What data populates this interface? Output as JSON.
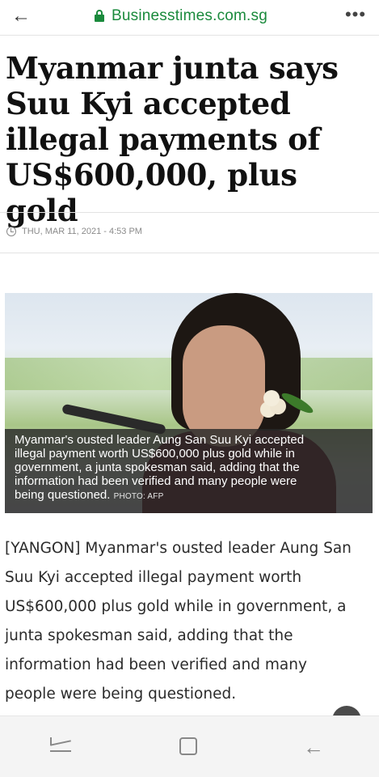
{
  "browser": {
    "url": "Businesstimes.com.sg",
    "back_icon": "←",
    "menu_icon": "•••"
  },
  "article": {
    "headline_lines": [
      "Myanmar junta says",
      "Suu Kyi accepted",
      "illegal payments of",
      "US$600,000, plus gold"
    ],
    "date": "THU, MAR 11, 2021 - 4:53 PM",
    "caption": {
      "lines": [
        "Myanmar's ousted leader Aung San Suu Kyi accepted",
        "illegal payment worth US$600,000 plus gold while in",
        "government, a junta spokesman said, adding that the",
        "information had been verified and many people were",
        "being questioned."
      ],
      "credit": "PHOTO: AFP"
    },
    "body_lines": [
      "[YANGON] Myanmar's ousted leader Aung San",
      "Suu Kyi accepted illegal payment worth",
      "US$600,000 plus gold while in government, a",
      "junta spokesman said, adding that the",
      "information had been verified and many",
      "people were being questioned."
    ]
  },
  "navbar": {
    "recent_icon": "recent-apps-icon",
    "home_icon": "home-icon",
    "back_icon": "←"
  },
  "colors": {
    "url_green": "#1a8a3c",
    "headline": "#111111",
    "caption_bg": "#282828"
  }
}
